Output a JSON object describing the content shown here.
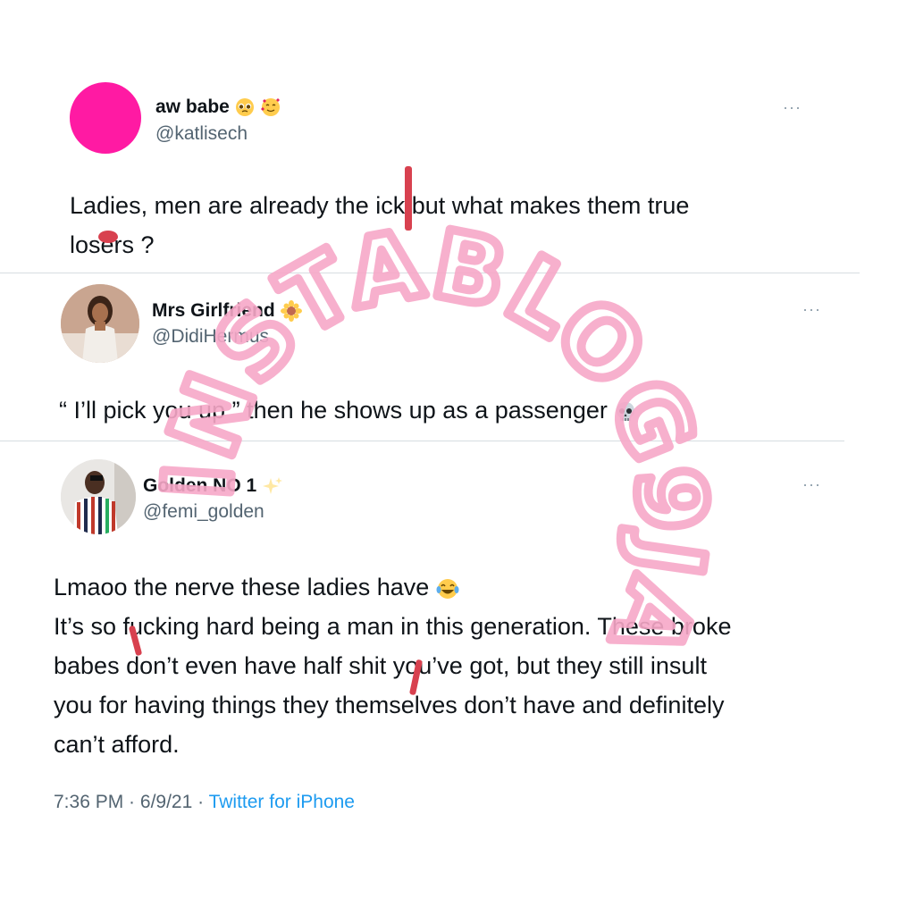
{
  "tweets": [
    {
      "name": "aw babe",
      "name_emojis": [
        "pleading-face-emoji",
        "smiling-face-with-hearts-emoji"
      ],
      "handle": "@katlisech",
      "lines": [
        "Ladies, men are already the ick but what makes them true",
        "losers ?"
      ],
      "avatar_color": "#ff1aa3"
    },
    {
      "name": "Mrs Girlfriend",
      "name_emojis": [
        "sunflower-emoji"
      ],
      "handle": "@DidiHermus",
      "lines": [
        "“ I’ll pick you up ” then he shows up as a passenger"
      ],
      "trailing_emoji": "skull-emoji"
    },
    {
      "name": "Golden NO 1",
      "name_emojis": [
        "sparkles-emoji"
      ],
      "handle": "@femi_golden",
      "lines": [
        "Lmaoo the nerve these ladies have",
        "It’s so fucking hard being a man in this generation. These broke",
        "babes don’t even have half shit you’ve got, but they still insult",
        "you for having things they themselves don’t have and definitely",
        "can’t afford."
      ],
      "trailing_emoji": "tears-of-joy-emoji"
    }
  ],
  "more_label": "···",
  "footer": {
    "time": "7:36 PM",
    "separator": " · ",
    "date": "6/9/21",
    "separator2": " · ",
    "source": "Twitter for iPhone"
  },
  "watermark": "INSTABLOG9JA",
  "colors": {
    "accent": "#1d9bf0",
    "watermark": "#f7a8c8",
    "redaction": "#d8414f"
  }
}
